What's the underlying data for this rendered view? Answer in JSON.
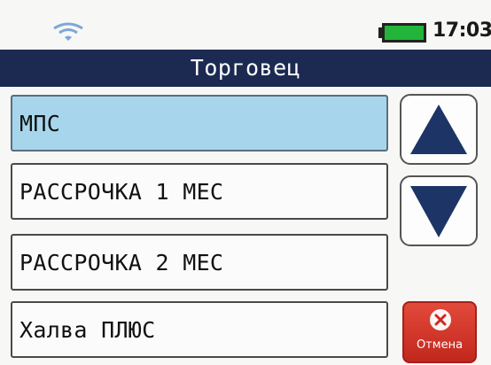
{
  "status_bar": {
    "time": "17:03",
    "wifi_icon": "wifi-icon",
    "battery_icon": "battery-icon",
    "battery_color": "#22b53a"
  },
  "title": "Торговец",
  "items": [
    {
      "label": "МПС",
      "selected": true
    },
    {
      "label": "РАССРОЧКА 1 МЕС",
      "selected": false
    },
    {
      "label": "РАССРОЧКА 2 МЕС",
      "selected": false
    },
    {
      "label": "Халва ПЛЮС",
      "selected": false
    }
  ],
  "buttons": {
    "up_icon": "triangle-up-icon",
    "down_icon": "triangle-down-icon",
    "cancel_label": "Отмена"
  },
  "colors": {
    "title_bar": "#1c2a52",
    "selected_item": "#a7d6ec",
    "arrow": "#1c3566",
    "cancel": "#d0342a"
  }
}
